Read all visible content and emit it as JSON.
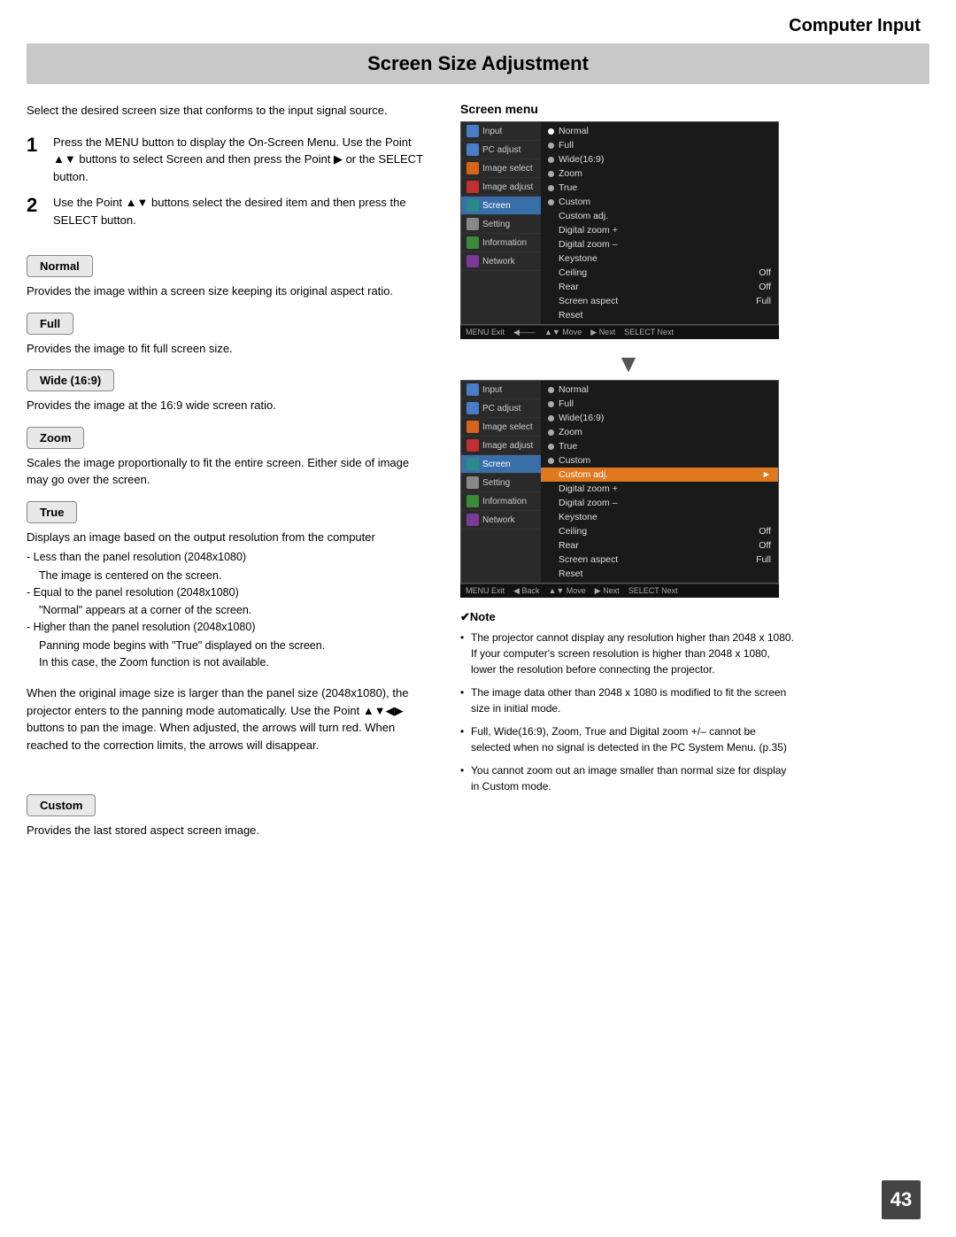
{
  "header": {
    "title": "Computer Input"
  },
  "section": {
    "title": "Screen Size Adjustment"
  },
  "intro": {
    "text": "Select the desired screen size that conforms to the input signal source."
  },
  "steps": [
    {
      "num": "1",
      "text": "Press the MENU button to display the On-Screen Menu. Use the Point ▲▼ buttons to select Screen and then press the Point ▶ or the SELECT button."
    },
    {
      "num": "2",
      "text": "Use the Point ▲▼ buttons select the desired item and then press the SELECT button."
    }
  ],
  "modes": {
    "normal": {
      "label": "Normal",
      "desc": "Provides the image within a screen size keeping its original aspect ratio."
    },
    "full": {
      "label": "Full",
      "desc": "Provides the image to fit full screen size."
    },
    "wide": {
      "label": "Wide (16:9)",
      "desc": "Provides the image at the 16:9 wide screen ratio."
    },
    "zoom": {
      "label": "Zoom",
      "desc": "Scales the image proportionally to fit the entire screen. Either side of image may go over the screen."
    },
    "true": {
      "label": "True",
      "desc": "Displays an image based on the output resolution from the computer",
      "sub1": "- Less than the panel resolution (2048x1080)",
      "sub1b": "The image is centered on the screen.",
      "sub2": "- Equal to the panel resolution (2048x1080)",
      "sub2b": "\"Normal\" appears at a corner of the screen.",
      "sub3": "- Higher than the panel resolution (2048x1080)",
      "sub3b": "Panning mode begins with \"True\" displayed on the screen.",
      "sub3c": "In this case, the Zoom function is not available.",
      "pan_text": "When the original image size is larger than the panel size (2048x1080), the projector enters to the panning mode automatically. Use the Point ▲▼◀▶ buttons to pan the image. When adjusted, the arrows will turn red. When reached to the correction limits, the arrows will disappear."
    },
    "custom": {
      "label": "Custom",
      "desc": "Provides the last stored aspect screen image."
    }
  },
  "screen_menu": {
    "label": "Screen menu",
    "osd1": {
      "sidebar": [
        {
          "label": "Input",
          "icon": "blue"
        },
        {
          "label": "PC adjust",
          "icon": "blue"
        },
        {
          "label": "Image select",
          "icon": "orange"
        },
        {
          "label": "Image adjust",
          "icon": "red"
        },
        {
          "label": "Screen",
          "icon": "teal",
          "active": true
        },
        {
          "label": "Setting",
          "icon": "gray"
        },
        {
          "label": "Information",
          "icon": "green"
        },
        {
          "label": "Network",
          "icon": "purple"
        }
      ],
      "items": [
        {
          "label": "Normal",
          "dot": "filled",
          "val": ""
        },
        {
          "label": "Full",
          "dot": "empty",
          "val": ""
        },
        {
          "label": "Wide(16:9)",
          "dot": "empty",
          "val": ""
        },
        {
          "label": "Zoom",
          "dot": "empty",
          "val": ""
        },
        {
          "label": "True",
          "dot": "empty",
          "val": ""
        },
        {
          "label": "Custom",
          "dot": "empty",
          "val": ""
        },
        {
          "label": "Custom adj.",
          "dot": "",
          "val": ""
        },
        {
          "label": "Digital zoom +",
          "dot": "",
          "val": ""
        },
        {
          "label": "Digital zoom –",
          "dot": "",
          "val": ""
        },
        {
          "label": "Keystone",
          "dot": "",
          "val": ""
        },
        {
          "label": "Ceiling",
          "dot": "",
          "val": "Off"
        },
        {
          "label": "Rear",
          "dot": "",
          "val": "Off"
        },
        {
          "label": "Screen aspect",
          "dot": "",
          "val": "Full"
        },
        {
          "label": "Reset",
          "dot": "",
          "val": ""
        }
      ],
      "bottom": "MENU Exit   ◀——   ▲▼ Move   ▶ Next   SELECT Next"
    },
    "osd2": {
      "sidebar": [
        {
          "label": "Input",
          "icon": "blue"
        },
        {
          "label": "PC adjust",
          "icon": "blue"
        },
        {
          "label": "Image select",
          "icon": "orange"
        },
        {
          "label": "Image adjust",
          "icon": "red"
        },
        {
          "label": "Screen",
          "icon": "teal",
          "active": true
        },
        {
          "label": "Setting",
          "icon": "gray"
        },
        {
          "label": "Information",
          "icon": "green"
        },
        {
          "label": "Network",
          "icon": "purple"
        }
      ],
      "items": [
        {
          "label": "Normal",
          "dot": "empty",
          "val": ""
        },
        {
          "label": "Full",
          "dot": "empty",
          "val": ""
        },
        {
          "label": "Wide(16:9)",
          "dot": "empty",
          "val": ""
        },
        {
          "label": "Zoom",
          "dot": "empty",
          "val": ""
        },
        {
          "label": "True",
          "dot": "empty",
          "val": ""
        },
        {
          "label": "Custom",
          "dot": "empty",
          "val": ""
        },
        {
          "label": "Custom adj.",
          "dot": "highlighted",
          "val": ""
        },
        {
          "label": "Digital zoom +",
          "dot": "",
          "val": ""
        },
        {
          "label": "Digital zoom –",
          "dot": "",
          "val": ""
        },
        {
          "label": "Keystone",
          "dot": "",
          "val": ""
        },
        {
          "label": "Ceiling",
          "dot": "",
          "val": "Off"
        },
        {
          "label": "Rear",
          "dot": "",
          "val": "Off"
        },
        {
          "label": "Screen aspect",
          "dot": "",
          "val": "Full"
        },
        {
          "label": "Reset",
          "dot": "",
          "val": ""
        }
      ],
      "bottom": "MENU Exit   ◀ Back   ▲▼ Move   ▶ Next   SELECT Next"
    }
  },
  "notes": {
    "title": "✔Note",
    "items": [
      "The projector cannot display any resolution higher than 2048 x 1080. If your computer's screen resolution is higher than 2048 x 1080, lower the resolution before connecting the projector.",
      "The image data other than 2048 x 1080 is modified to fit the screen size in initial mode.",
      "Full, Wide(16:9), Zoom, True and Digital zoom +/– cannot be selected when no signal is detected in the PC System Menu. (p.35)",
      "You cannot zoom out  an image smaller than normal size for display in Custom mode."
    ]
  },
  "page_number": "43"
}
